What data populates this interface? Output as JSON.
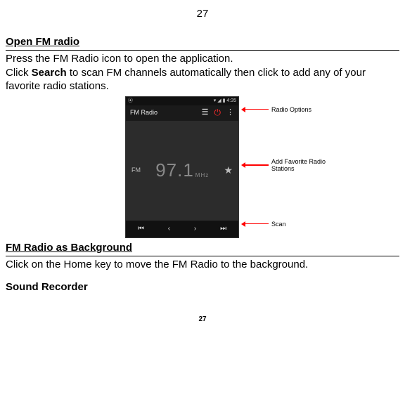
{
  "page_top_num": "27",
  "page_bottom_num": "27",
  "section1_title": "Open FM radio",
  "section1_line1": "Press the FM Radio icon to open the application.",
  "section1_line2a": "Click ",
  "section1_line2b": "Search",
  "section1_line2c": " to scan FM channels automatically then click to add any of your favorite radio stations.",
  "phone": {
    "status_time": "4:35",
    "app_title": "FM Radio",
    "fm_label": "FM",
    "freq": "97.1",
    "mhz": "MHz"
  },
  "callouts": {
    "options": "Radio Options",
    "favorite_l1": "Add Favorite Radio",
    "favorite_l2": "Stations",
    "scan": "Scan"
  },
  "section2_title": "FM Radio as Background",
  "section2_body": "Click on the Home key to move the FM Radio to the background.",
  "section3_title": "Sound Recorder"
}
